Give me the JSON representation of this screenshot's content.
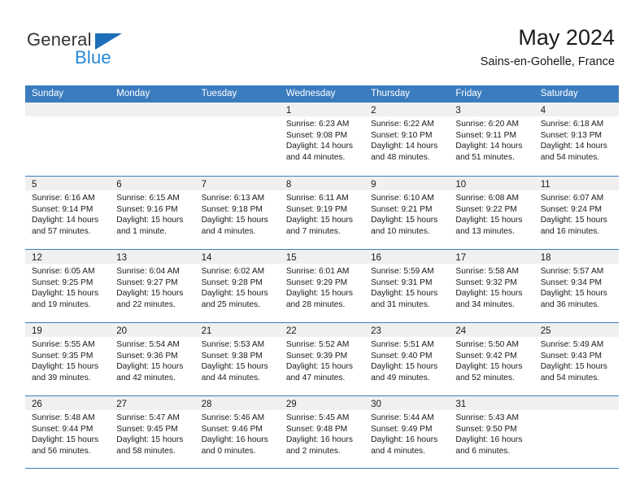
{
  "brand": {
    "name_top": "General",
    "name_bottom": "Blue",
    "color_primary": "#1d6fb8",
    "color_secondary": "#2688d6"
  },
  "header": {
    "title": "May 2024",
    "subtitle": "Sains-en-Gohelle, France"
  },
  "calendar": {
    "header_bg": "#3b7cbf",
    "weekdays": [
      "Sunday",
      "Monday",
      "Tuesday",
      "Wednesday",
      "Thursday",
      "Friday",
      "Saturday"
    ],
    "weeks": [
      [
        {
          "day": "",
          "sunrise": "",
          "sunset": "",
          "daylight": "",
          "empty": true
        },
        {
          "day": "",
          "sunrise": "",
          "sunset": "",
          "daylight": "",
          "empty": true
        },
        {
          "day": "",
          "sunrise": "",
          "sunset": "",
          "daylight": "",
          "empty": true
        },
        {
          "day": "1",
          "sunrise": "Sunrise: 6:23 AM",
          "sunset": "Sunset: 9:08 PM",
          "daylight": "Daylight: 14 hours and 44 minutes."
        },
        {
          "day": "2",
          "sunrise": "Sunrise: 6:22 AM",
          "sunset": "Sunset: 9:10 PM",
          "daylight": "Daylight: 14 hours and 48 minutes."
        },
        {
          "day": "3",
          "sunrise": "Sunrise: 6:20 AM",
          "sunset": "Sunset: 9:11 PM",
          "daylight": "Daylight: 14 hours and 51 minutes."
        },
        {
          "day": "4",
          "sunrise": "Sunrise: 6:18 AM",
          "sunset": "Sunset: 9:13 PM",
          "daylight": "Daylight: 14 hours and 54 minutes."
        }
      ],
      [
        {
          "day": "5",
          "sunrise": "Sunrise: 6:16 AM",
          "sunset": "Sunset: 9:14 PM",
          "daylight": "Daylight: 14 hours and 57 minutes."
        },
        {
          "day": "6",
          "sunrise": "Sunrise: 6:15 AM",
          "sunset": "Sunset: 9:16 PM",
          "daylight": "Daylight: 15 hours and 1 minute."
        },
        {
          "day": "7",
          "sunrise": "Sunrise: 6:13 AM",
          "sunset": "Sunset: 9:18 PM",
          "daylight": "Daylight: 15 hours and 4 minutes."
        },
        {
          "day": "8",
          "sunrise": "Sunrise: 6:11 AM",
          "sunset": "Sunset: 9:19 PM",
          "daylight": "Daylight: 15 hours and 7 minutes."
        },
        {
          "day": "9",
          "sunrise": "Sunrise: 6:10 AM",
          "sunset": "Sunset: 9:21 PM",
          "daylight": "Daylight: 15 hours and 10 minutes."
        },
        {
          "day": "10",
          "sunrise": "Sunrise: 6:08 AM",
          "sunset": "Sunset: 9:22 PM",
          "daylight": "Daylight: 15 hours and 13 minutes."
        },
        {
          "day": "11",
          "sunrise": "Sunrise: 6:07 AM",
          "sunset": "Sunset: 9:24 PM",
          "daylight": "Daylight: 15 hours and 16 minutes."
        }
      ],
      [
        {
          "day": "12",
          "sunrise": "Sunrise: 6:05 AM",
          "sunset": "Sunset: 9:25 PM",
          "daylight": "Daylight: 15 hours and 19 minutes."
        },
        {
          "day": "13",
          "sunrise": "Sunrise: 6:04 AM",
          "sunset": "Sunset: 9:27 PM",
          "daylight": "Daylight: 15 hours and 22 minutes."
        },
        {
          "day": "14",
          "sunrise": "Sunrise: 6:02 AM",
          "sunset": "Sunset: 9:28 PM",
          "daylight": "Daylight: 15 hours and 25 minutes."
        },
        {
          "day": "15",
          "sunrise": "Sunrise: 6:01 AM",
          "sunset": "Sunset: 9:29 PM",
          "daylight": "Daylight: 15 hours and 28 minutes."
        },
        {
          "day": "16",
          "sunrise": "Sunrise: 5:59 AM",
          "sunset": "Sunset: 9:31 PM",
          "daylight": "Daylight: 15 hours and 31 minutes."
        },
        {
          "day": "17",
          "sunrise": "Sunrise: 5:58 AM",
          "sunset": "Sunset: 9:32 PM",
          "daylight": "Daylight: 15 hours and 34 minutes."
        },
        {
          "day": "18",
          "sunrise": "Sunrise: 5:57 AM",
          "sunset": "Sunset: 9:34 PM",
          "daylight": "Daylight: 15 hours and 36 minutes."
        }
      ],
      [
        {
          "day": "19",
          "sunrise": "Sunrise: 5:55 AM",
          "sunset": "Sunset: 9:35 PM",
          "daylight": "Daylight: 15 hours and 39 minutes."
        },
        {
          "day": "20",
          "sunrise": "Sunrise: 5:54 AM",
          "sunset": "Sunset: 9:36 PM",
          "daylight": "Daylight: 15 hours and 42 minutes."
        },
        {
          "day": "21",
          "sunrise": "Sunrise: 5:53 AM",
          "sunset": "Sunset: 9:38 PM",
          "daylight": "Daylight: 15 hours and 44 minutes."
        },
        {
          "day": "22",
          "sunrise": "Sunrise: 5:52 AM",
          "sunset": "Sunset: 9:39 PM",
          "daylight": "Daylight: 15 hours and 47 minutes."
        },
        {
          "day": "23",
          "sunrise": "Sunrise: 5:51 AM",
          "sunset": "Sunset: 9:40 PM",
          "daylight": "Daylight: 15 hours and 49 minutes."
        },
        {
          "day": "24",
          "sunrise": "Sunrise: 5:50 AM",
          "sunset": "Sunset: 9:42 PM",
          "daylight": "Daylight: 15 hours and 52 minutes."
        },
        {
          "day": "25",
          "sunrise": "Sunrise: 5:49 AM",
          "sunset": "Sunset: 9:43 PM",
          "daylight": "Daylight: 15 hours and 54 minutes."
        }
      ],
      [
        {
          "day": "26",
          "sunrise": "Sunrise: 5:48 AM",
          "sunset": "Sunset: 9:44 PM",
          "daylight": "Daylight: 15 hours and 56 minutes."
        },
        {
          "day": "27",
          "sunrise": "Sunrise: 5:47 AM",
          "sunset": "Sunset: 9:45 PM",
          "daylight": "Daylight: 15 hours and 58 minutes."
        },
        {
          "day": "28",
          "sunrise": "Sunrise: 5:46 AM",
          "sunset": "Sunset: 9:46 PM",
          "daylight": "Daylight: 16 hours and 0 minutes."
        },
        {
          "day": "29",
          "sunrise": "Sunrise: 5:45 AM",
          "sunset": "Sunset: 9:48 PM",
          "daylight": "Daylight: 16 hours and 2 minutes."
        },
        {
          "day": "30",
          "sunrise": "Sunrise: 5:44 AM",
          "sunset": "Sunset: 9:49 PM",
          "daylight": "Daylight: 16 hours and 4 minutes."
        },
        {
          "day": "31",
          "sunrise": "Sunrise: 5:43 AM",
          "sunset": "Sunset: 9:50 PM",
          "daylight": "Daylight: 16 hours and 6 minutes."
        },
        {
          "day": "",
          "sunrise": "",
          "sunset": "",
          "daylight": "",
          "empty": true
        }
      ]
    ]
  }
}
